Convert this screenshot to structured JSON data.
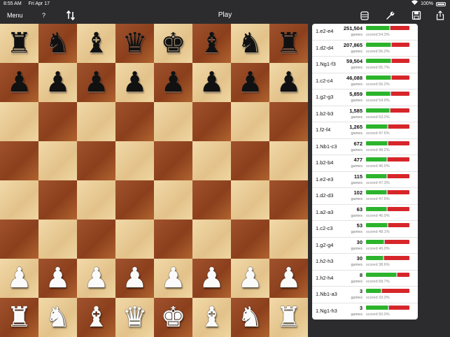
{
  "status": {
    "time": "8:55 AM",
    "date": "Fri Apr 17",
    "battery": "100%"
  },
  "toolbar": {
    "menu": "Menu",
    "help": "?",
    "title": "Play",
    "icons": [
      "flip-board-icon",
      "database-icon",
      "wrench-icon",
      "save-icon",
      "share-icon"
    ]
  },
  "board": {
    "ranks": [
      [
        "bR",
        "bN",
        "bB",
        "bQ",
        "bK",
        "bB",
        "bN",
        "bR"
      ],
      [
        "bP",
        "bP",
        "bP",
        "bP",
        "bP",
        "bP",
        "bP",
        "bP"
      ],
      [
        "",
        "",
        "",
        "",
        "",
        "",
        "",
        ""
      ],
      [
        "",
        "",
        "",
        "",
        "",
        "",
        "",
        ""
      ],
      [
        "",
        "",
        "",
        "",
        "",
        "",
        "",
        ""
      ],
      [
        "",
        "",
        "",
        "",
        "",
        "",
        "",
        ""
      ],
      [
        "wP",
        "wP",
        "wP",
        "wP",
        "wP",
        "wP",
        "wP",
        "wP"
      ],
      [
        "wR",
        "wN",
        "wB",
        "wQ",
        "wK",
        "wB",
        "wN",
        "wR"
      ]
    ]
  },
  "stats": {
    "games_label": "games",
    "moves": [
      {
        "move": "1.e2-e4",
        "games": "251,504",
        "scored": "scored 54.3%",
        "w": 0.54
      },
      {
        "move": "1.d2-d4",
        "games": "207,865",
        "scored": "scored 56.2%",
        "w": 0.56
      },
      {
        "move": "1.Ng1-f3",
        "games": "59,504",
        "scored": "scored 55.7%",
        "w": 0.56
      },
      {
        "move": "1.c2-c4",
        "games": "46,088",
        "scored": "scored 56.2%",
        "w": 0.56
      },
      {
        "move": "1.g2-g3",
        "games": "5,859",
        "scored": "scored 54.9%",
        "w": 0.55
      },
      {
        "move": "1.b2-b3",
        "games": "1,585",
        "scored": "scored 53.2%",
        "w": 0.53
      },
      {
        "move": "1.f2-f4",
        "games": "1,265",
        "scored": "scored 47.6%",
        "w": 0.48
      },
      {
        "move": "1.Nb1-c3",
        "games": "672",
        "scored": "scored 48.2%",
        "w": 0.48
      },
      {
        "move": "1.b2-b4",
        "games": "477",
        "scored": "scored 46.0%",
        "w": 0.46
      },
      {
        "move": "1.e2-e3",
        "games": "115",
        "scored": "scored 47.3%",
        "w": 0.47
      },
      {
        "move": "1.d2-d3",
        "games": "102",
        "scored": "scored 47.5%",
        "w": 0.475
      },
      {
        "move": "1.a2-a3",
        "games": "63",
        "scored": "scored 46.0%",
        "w": 0.46
      },
      {
        "move": "1.c2-c3",
        "games": "53",
        "scored": "scored 48.1%",
        "w": 0.48
      },
      {
        "move": "1.g2-g4",
        "games": "30",
        "scored": "scored 40.0%",
        "w": 0.4
      },
      {
        "move": "1.h2-h3",
        "games": "30",
        "scored": "scored 38.6%",
        "w": 0.386
      },
      {
        "move": "1.h2-h4",
        "games": "8",
        "scored": "scored 68.7%",
        "w": 0.687
      },
      {
        "move": "1.Nb1-a3",
        "games": "3",
        "scored": "scored 33.3%",
        "w": 0.333
      },
      {
        "move": "1.Ng1-h3",
        "games": "3",
        "scored": "scored 50.0%",
        "w": 0.5
      }
    ]
  }
}
